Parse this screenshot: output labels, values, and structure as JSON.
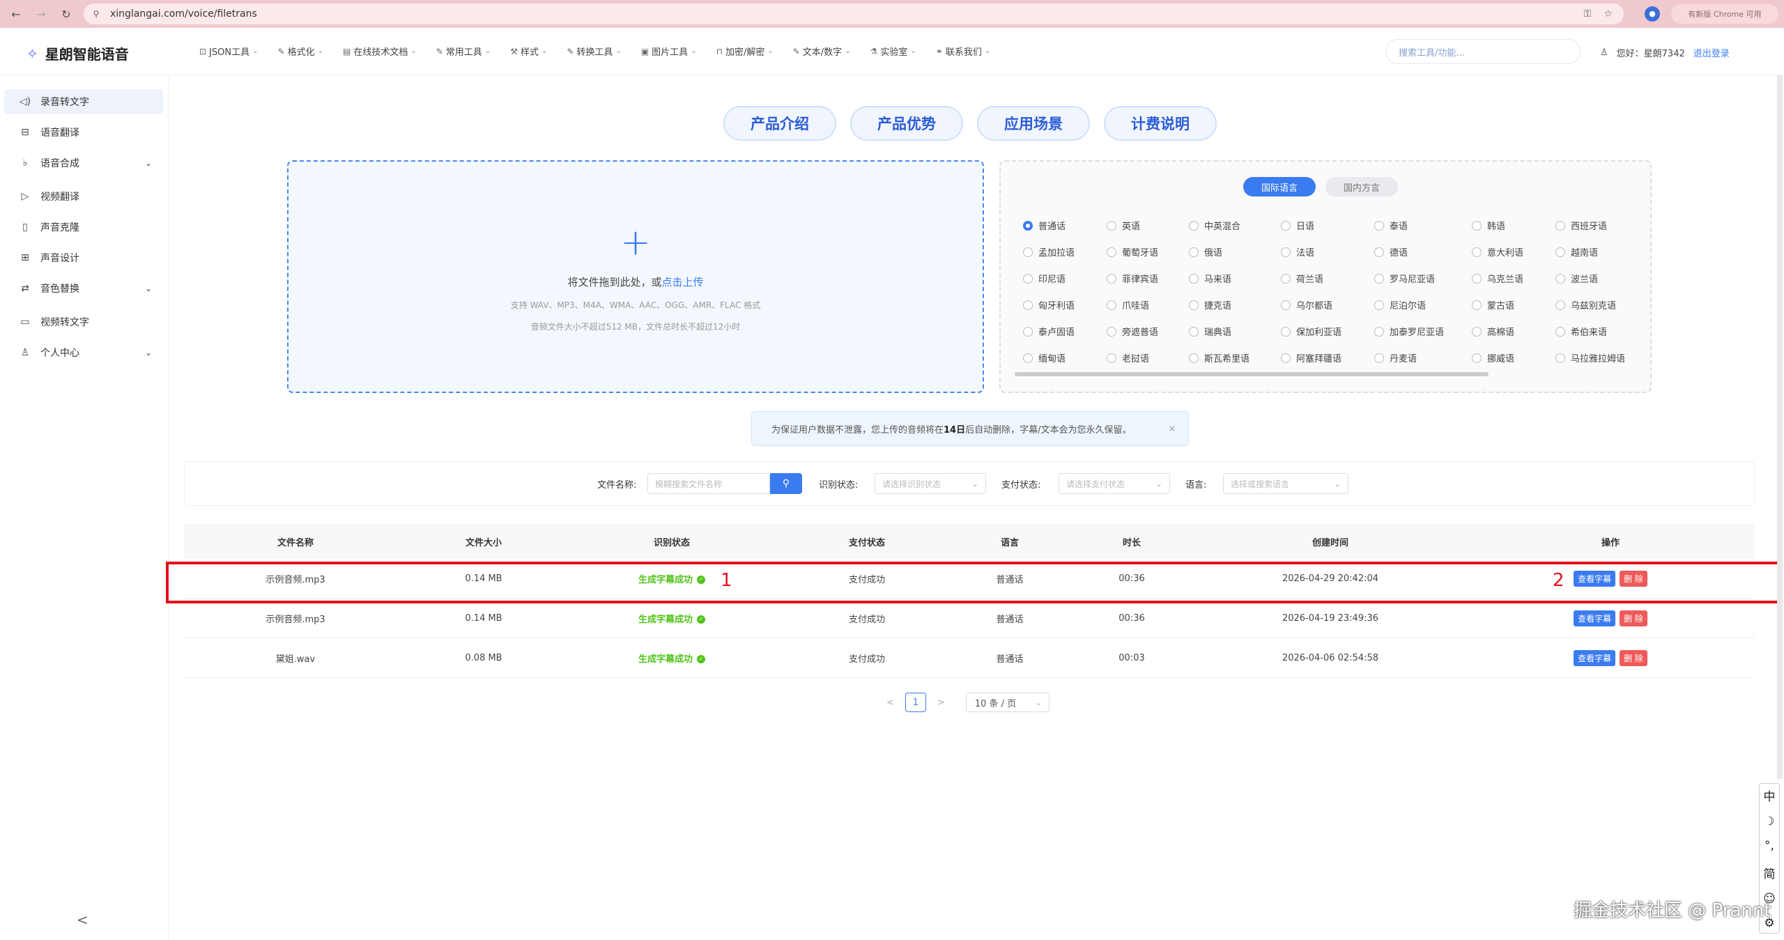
{
  "browser": {
    "url": "xinglangai.com/voice/filetrans",
    "update_pill": "有新版 Chrome 可用"
  },
  "header": {
    "logo_text": "星朗智能语音",
    "menus": [
      {
        "label": "JSON工具",
        "icon": "json-icon"
      },
      {
        "label": "格式化",
        "icon": "edit-icon"
      },
      {
        "label": "在线技术文档",
        "icon": "doc-icon"
      },
      {
        "label": "常用工具",
        "icon": "edit-icon"
      },
      {
        "label": "样式",
        "icon": "brush-icon"
      },
      {
        "label": "转换工具",
        "icon": "edit-icon"
      },
      {
        "label": "图片工具",
        "icon": "image-icon"
      },
      {
        "label": "加密/解密",
        "icon": "lock-icon"
      },
      {
        "label": "文本/数字",
        "icon": "edit-icon"
      },
      {
        "label": "实验室",
        "icon": "flask-icon"
      },
      {
        "label": "联系我们",
        "icon": "link-icon"
      }
    ],
    "search_placeholder": "搜索工具/功能...",
    "greeting": "您好：星朗7342",
    "logout": "退出登录"
  },
  "sidebar": {
    "items": [
      {
        "label": "录音转文字",
        "icon": "speaker-icon",
        "active": true
      },
      {
        "label": "语音翻译",
        "icon": "translate-icon"
      },
      {
        "label": "语音合成",
        "icon": "mic-icon",
        "expandable": true
      },
      {
        "label": "视频翻译",
        "icon": "video-play-icon"
      },
      {
        "label": "声音克隆",
        "icon": "clone-icon"
      },
      {
        "label": "声音设计",
        "icon": "design-icon"
      },
      {
        "label": "音色替换",
        "icon": "swap-icon",
        "expandable": true
      },
      {
        "label": "视频转文字",
        "icon": "video-icon"
      },
      {
        "label": "个人中心",
        "icon": "user-icon",
        "expandable": true
      }
    ],
    "collapse_icon": "<"
  },
  "tabs": [
    "产品介绍",
    "产品优势",
    "应用场景",
    "计费说明"
  ],
  "upload": {
    "plus": "+",
    "prompt": "将文件拖到此处，或",
    "link": "点击上传",
    "formats": "支持 WAV、MP3、M4A、WMA、AAC、OGG、AMR、FLAC 格式",
    "limits": "音频文件大小不超过512 MB，文件总时长不超过12小时"
  },
  "language_panel": {
    "tabs": [
      "国际语言",
      "国内方言"
    ],
    "selected": "普通话",
    "rows": [
      [
        "普通话",
        "英语",
        "中英混合",
        "日语",
        "泰语",
        "韩语",
        "西班牙语"
      ],
      [
        "孟加拉语",
        "葡萄牙语",
        "俄语",
        "法语",
        "德语",
        "意大利语",
        "越南语"
      ],
      [
        "印尼语",
        "菲律宾语",
        "马来语",
        "荷兰语",
        "罗马尼亚语",
        "乌克兰语",
        "波兰语"
      ],
      [
        "匈牙利语",
        "爪哇语",
        "捷克语",
        "乌尔都语",
        "尼泊尔语",
        "蒙古语",
        "乌兹别克语"
      ],
      [
        "泰卢固语",
        "旁遮普语",
        "瑞典语",
        "保加利亚语",
        "加泰罗尼亚语",
        "高棉语",
        "希伯来语"
      ],
      [
        "缅甸语",
        "老挝语",
        "斯瓦希里语",
        "阿塞拜疆语",
        "丹麦语",
        "挪威语",
        "马拉雅拉姆语"
      ]
    ]
  },
  "notice": {
    "text_before": "为保证用户数据不泄露，您上传的音频将在",
    "bold": "14日",
    "text_after": "后自动删除，字幕/文本会为您永久保留。",
    "close": "×"
  },
  "filters": {
    "filename_label": "文件名称:",
    "filename_placeholder": "模糊搜索文件名称",
    "status_label": "识别状态:",
    "status_placeholder": "请选择识别状态",
    "pay_label": "支付状态:",
    "pay_placeholder": "请选择支付状态",
    "lang_label": "语言:",
    "lang_placeholder": "选择或搜索语言"
  },
  "table": {
    "headers": [
      "文件名称",
      "文件大小",
      "识别状态",
      "支付状态",
      "语言",
      "时长",
      "创建时间",
      "操作"
    ],
    "rows": [
      {
        "name": "示例音频.mp3",
        "size": "0.14 MB",
        "status": "生成字幕成功",
        "pay": "支付成功",
        "lang": "普通话",
        "duration": "00:36",
        "created": "2026-04-29 20:42:04",
        "view": "查看字幕",
        "del": "删 除"
      },
      {
        "name": "示例音频.mp3",
        "size": "0.14 MB",
        "status": "生成字幕成功",
        "pay": "支付成功",
        "lang": "普通话",
        "duration": "00:36",
        "created": "2026-04-19 23:49:36",
        "view": "查看字幕",
        "del": "删 除"
      },
      {
        "name": "黛姐.wav",
        "size": "0.08 MB",
        "status": "生成字幕成功",
        "pay": "支付成功",
        "lang": "普通话",
        "duration": "00:03",
        "created": "2026-04-06 02:54:58",
        "view": "查看字幕",
        "del": "删 除"
      }
    ]
  },
  "annotations": {
    "one": "1",
    "two": "2"
  },
  "pagination": {
    "prev": "<",
    "page": "1",
    "next": ">",
    "page_size": "10 条 / 页"
  },
  "ime": [
    "中",
    "☽",
    "°,",
    "简",
    "☺",
    "⚙"
  ],
  "watermark": "掘金技术社区 @ Prannt"
}
